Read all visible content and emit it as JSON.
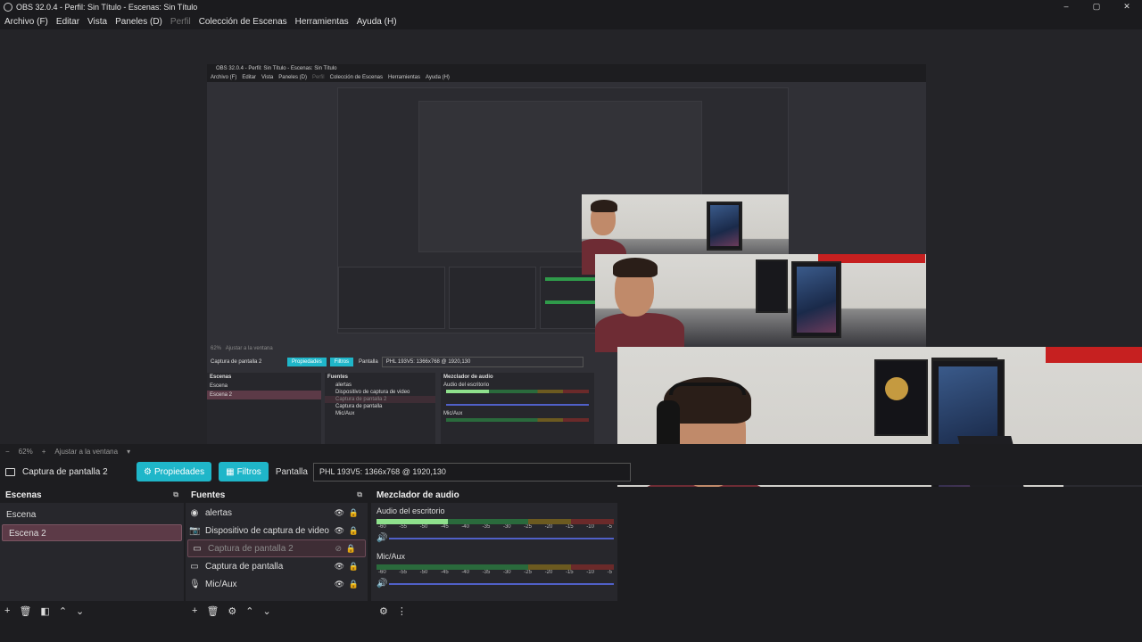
{
  "window": {
    "title": "OBS 32.0.4 - Perfil: Sin Título - Escenas: Sin Título",
    "minimize": "–",
    "maximize": "▢",
    "close": "✕"
  },
  "menu": [
    "Archivo (F)",
    "Editar",
    "Vista",
    "Paneles (D)",
    "Perfil",
    "Colección de Escenas",
    "Herramientas",
    "Ayuda (H)"
  ],
  "nested": {
    "title": "OBS 32.0.4 - Perfil: Sin Título - Escenas: Sin Título",
    "menu": [
      "Archivo (F)",
      "Editar",
      "Vista",
      "Paneles (D)",
      "Perfil",
      "Colección de Escenas",
      "Herramientas",
      "Ayuda (H)"
    ],
    "zoom": "62%",
    "fit": "Ajustar a la ventana",
    "source_name": "Captura de pantalla 2",
    "properties": "Propiedades",
    "filters": "Filtros",
    "display_label": "Pantalla",
    "display_value": "PHL 193V5: 1366x768 @ 1920,130",
    "scenes_title": "Escenas",
    "scenes": [
      "Escena",
      "Escena 2"
    ],
    "sources_title": "Fuentes",
    "sources": [
      "alertas",
      "Dispositivo de captura de video",
      "Captura de pantalla 2",
      "Captura de pantalla",
      "Mic/Aux"
    ],
    "mixer_title": "Mezclador de audio",
    "ch1": "Audio del escritorio",
    "ch2": "Mic/Aux"
  },
  "scalebar": {
    "minus": "−",
    "zoom": "62%",
    "plus": "+",
    "fit": "Ajustar a la ventana"
  },
  "source_bar": {
    "name": "Captura de pantalla 2",
    "properties": "Propiedades",
    "filters": "Filtros",
    "display_label": "Pantalla",
    "display_value": "PHL 193V5: 1366x768 @ 1920,130"
  },
  "scenes": {
    "title": "Escenas",
    "items": [
      "Escena",
      "Escena 2"
    ]
  },
  "sources": {
    "title": "Fuentes",
    "items": [
      {
        "name": "alertas",
        "icon": "browser-icon"
      },
      {
        "name": "Dispositivo de captura de video",
        "icon": "camera-icon"
      },
      {
        "name": "Captura de pantalla 2",
        "icon": "monitor-icon"
      },
      {
        "name": "Captura de pantalla",
        "icon": "monitor-icon"
      },
      {
        "name": "Mic/Aux",
        "icon": "mic-icon"
      }
    ]
  },
  "mixer": {
    "title": "Mezclador de audio",
    "channels": [
      {
        "name": "Audio del escritorio",
        "level": 0.3
      },
      {
        "name": "Mic/Aux",
        "level": 0.0
      }
    ],
    "ticks": [
      "-60",
      "-55",
      "-50",
      "-45",
      "-40",
      "-35",
      "-30",
      "-25",
      "-20",
      "-15",
      "-10",
      "-5"
    ],
    "zero": "0"
  },
  "colors": {
    "accent": "#1fb6c9",
    "selected": "#5c3a47",
    "meter_green": "#2a6a3c",
    "meter_lvl": "#8ee08c",
    "slider": "#5060c8"
  }
}
